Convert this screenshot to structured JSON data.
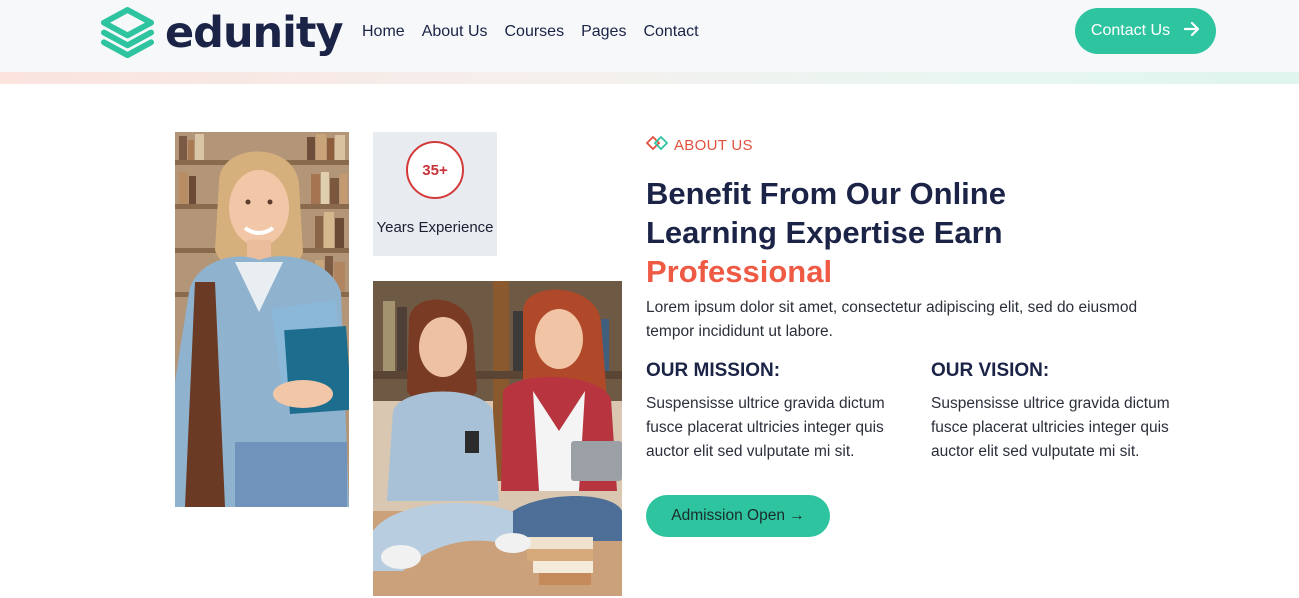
{
  "brand": {
    "name": "edunity",
    "logo_icon": "stacked-books-icon",
    "colors": {
      "primary": "#2ec4a0",
      "accent": "#ef5a44",
      "navy": "#1b2447"
    }
  },
  "nav": {
    "items": [
      {
        "label": "Home"
      },
      {
        "label": "About Us"
      },
      {
        "label": "Courses"
      },
      {
        "label": "Pages"
      },
      {
        "label": "Contact"
      }
    ],
    "contact_button": {
      "label": "Contact Us",
      "icon": "arrow-right-icon"
    }
  },
  "experience": {
    "value": "35+",
    "label": "Years Experience"
  },
  "about": {
    "tag": "ABOUT US",
    "heading_line1": "Benefit From Our Online",
    "heading_line2": "Learning Expertise Earn",
    "heading_accent": "Professional",
    "intro": "Lorem ipsum dolor sit amet, consectetur adipiscing elit, sed do eiusmod tempor incididunt ut labore.",
    "mission": {
      "title": "OUR MISSION:",
      "text": "Suspensisse ultrice gravida dictum fusce placerat ultricies integer quis auctor elit sed vulputate mi sit."
    },
    "vision": {
      "title": "OUR VISION:",
      "text": "Suspensisse ultrice gravida dictum fusce placerat ultricies integer quis auctor elit sed vulputate mi sit."
    },
    "cta": "Admission Open →"
  }
}
